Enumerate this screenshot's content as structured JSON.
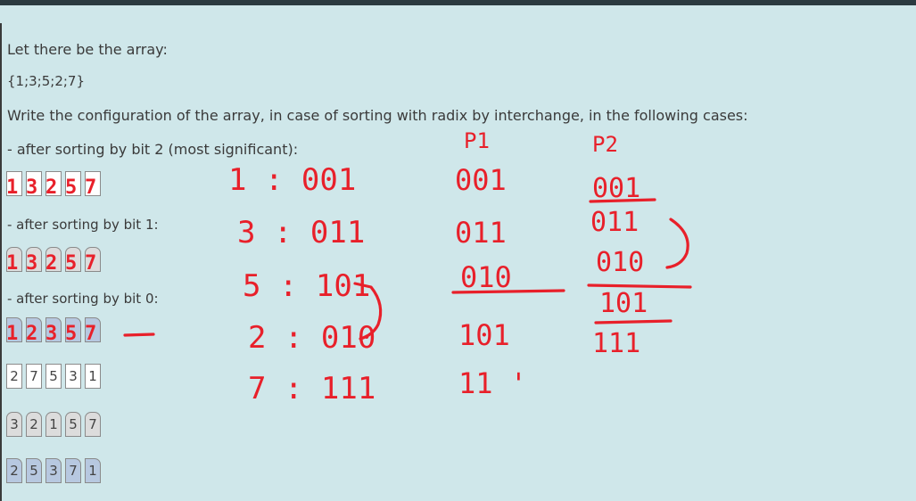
{
  "question": {
    "intro": "Let there be the array:",
    "array_text": "{1;3;5;2;7}",
    "instruction": "Write the configuration of the array, in case of sorting with radix by interchange, in the following cases:",
    "case_bit2": "- after sorting by bit 2 (most significant):",
    "case_bit1": "- after sorting by bit 1:",
    "case_bit0": "- after sorting by bit 0:"
  },
  "rows": {
    "white_row": [
      "2",
      "7",
      "5",
      "3",
      "1"
    ],
    "gray_row": [
      "3",
      "2",
      "1",
      "5",
      "7"
    ],
    "blue_row": [
      "2",
      "5",
      "3",
      "7",
      "1"
    ]
  },
  "answers": {
    "bit2": [
      "1",
      "3",
      "2",
      "5",
      "7"
    ],
    "bit1": [
      "1",
      "3",
      "2",
      "5",
      "7"
    ],
    "bit0": [
      "1",
      "2",
      "3",
      "5",
      "7"
    ]
  },
  "handwriting": {
    "binary_lines": [
      "1 : 001",
      "3 : 011",
      "5 : 101",
      "2 : 010",
      "7 : 111"
    ],
    "p1_label": "P1",
    "p2_label": "P2",
    "p1_col": [
      "001",
      "011",
      "010",
      "101",
      "11 '"
    ],
    "p2_col": [
      "001",
      "011",
      "010",
      "101",
      "111"
    ]
  },
  "colors": {
    "panel_bg": "#cfe7ea",
    "ink": "#e8202a",
    "cell_white": "#ffffff",
    "cell_gray": "#dcdcdc",
    "cell_blue": "#b7c8e0"
  }
}
